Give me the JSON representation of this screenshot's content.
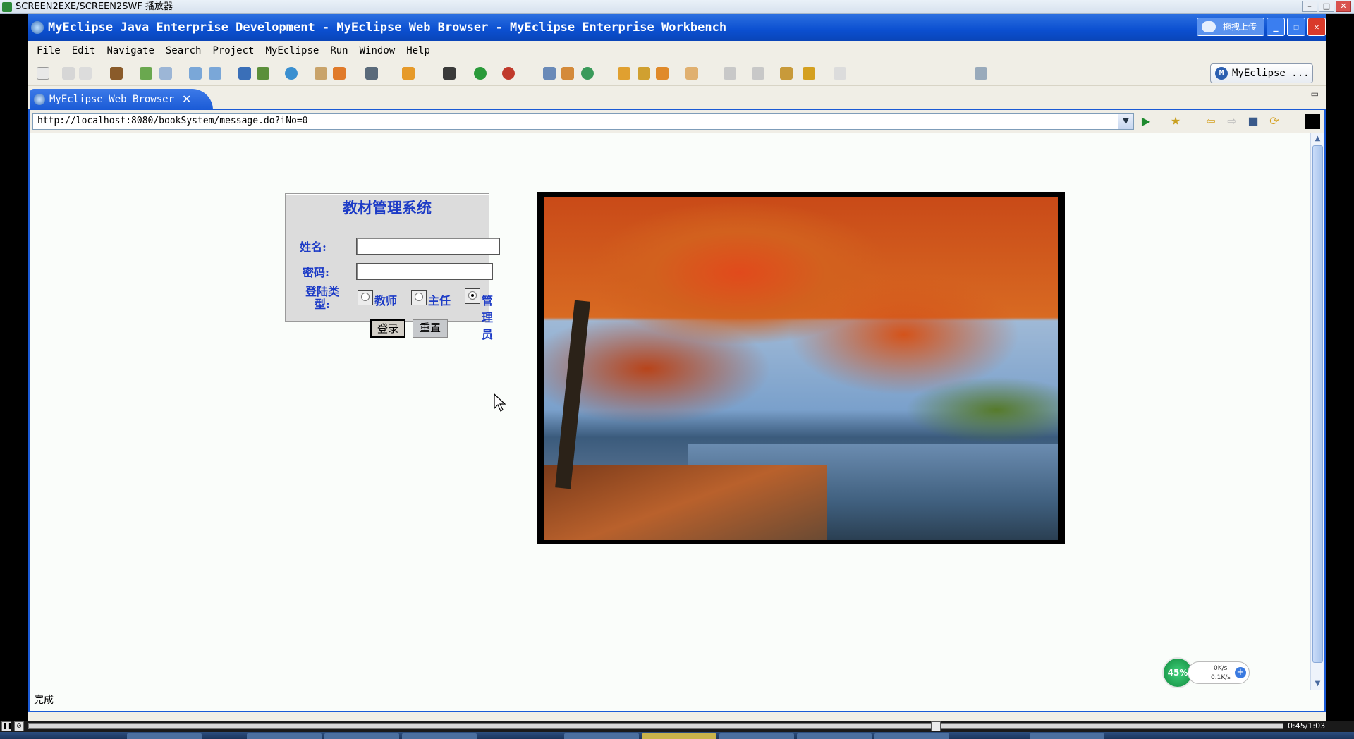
{
  "player": {
    "title": "SCREEN2EXE/SCREEN2SWF 播放器",
    "time": "0:45/1:03"
  },
  "window": {
    "title": "MyEclipse Java Enterprise Development - MyEclipse Web Browser - MyEclipse Enterprise Workbench",
    "upload_label": "拖拽上传"
  },
  "menu": [
    "File",
    "Edit",
    "Navigate",
    "Search",
    "Project",
    "MyEclipse",
    "Run",
    "Window",
    "Help"
  ],
  "perspective": {
    "label": "MyEclipse ..."
  },
  "editor_tab": {
    "label": "MyEclipse Web Browser",
    "close": "✕"
  },
  "browser": {
    "url": "http://localhost:8080/bookSystem/message.do?iNo=0",
    "status": "完成"
  },
  "login": {
    "title": "教材管理系统",
    "name_label": "姓名:",
    "password_label": "密码:",
    "type_label": "登陆类型:",
    "options": [
      {
        "label": "教师",
        "selected": false
      },
      {
        "label": "主任",
        "selected": false
      },
      {
        "label": "管理员",
        "selected": true
      }
    ],
    "login_button": "登录",
    "reset_button": "重置"
  },
  "net_meter": {
    "percent": "45%",
    "up": "0K/s",
    "down": "0.1K/s"
  },
  "colors": {
    "title_blue": "#0b4fd0",
    "form_text": "#1c3bc6",
    "form_bg": "#dcdcdc"
  }
}
